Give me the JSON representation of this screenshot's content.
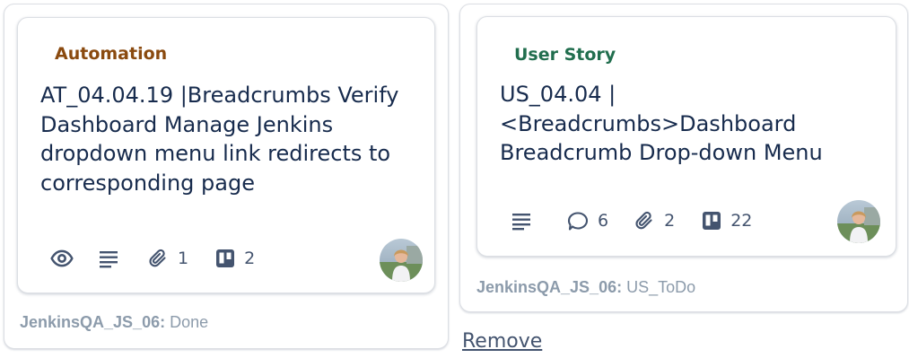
{
  "cards": [
    {
      "label": "Automation",
      "label_color": "#8a4a0f",
      "title": "AT_04.04.19 |Breadcrumbs Verify\nDashboard Manage Jenkins\ndropdown menu link redirects to\ncorresponding page",
      "badges": {
        "attachments": "1",
        "checklist": "2"
      },
      "footer": {
        "board": "JenkinsQA_JS_06:",
        "list": "Done"
      }
    },
    {
      "label": "User Story",
      "label_color": "#216e4e",
      "title": "US_04.04 |\n<Breadcrumbs>Dashboard\nBreadcrumb Drop-down Menu",
      "badges": {
        "comments": "6",
        "attachments": "2",
        "checklist": "22"
      },
      "footer": {
        "board": "JenkinsQA_JS_06:",
        "list": "US_ToDo"
      }
    }
  ],
  "remove_label": "Remove"
}
